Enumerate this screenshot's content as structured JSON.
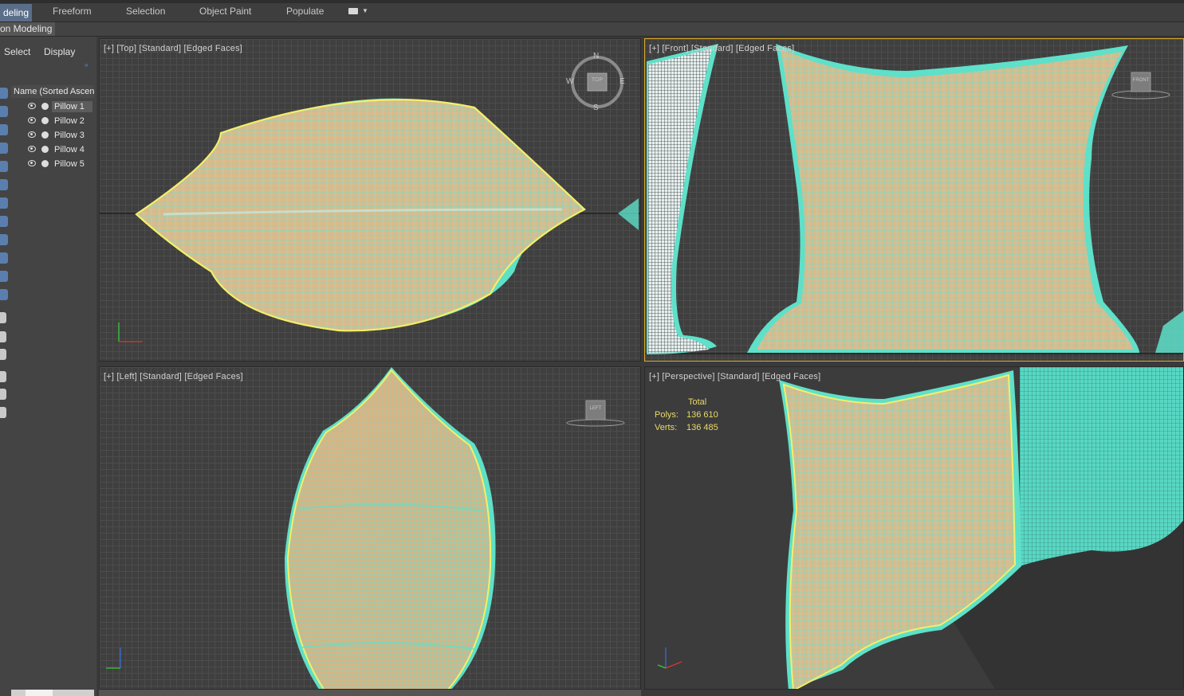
{
  "ribbon": {
    "tabs": [
      "deling",
      "Freeform",
      "Selection",
      "Object Paint",
      "Populate"
    ],
    "extra_icon": "message-dropdown-icon"
  },
  "subribbon": {
    "label": "on Modeling"
  },
  "scene_explorer": {
    "menu": [
      "Select",
      "Display"
    ],
    "column_header": "Name (Sorted Ascending)",
    "items": [
      {
        "label": "Pillow 1",
        "selected": true
      },
      {
        "label": "Pillow 2",
        "selected": false
      },
      {
        "label": "Pillow 3",
        "selected": false
      },
      {
        "label": "Pillow 4",
        "selected": false
      },
      {
        "label": "Pillow 5",
        "selected": false
      }
    ]
  },
  "viewports": {
    "top": {
      "label": "[+] [Top] [Standard] [Edged Faces]",
      "viewcube": {
        "face": "TOP",
        "n": "N",
        "s": "S",
        "e": "E",
        "w": "W"
      }
    },
    "front": {
      "label": "[+] [Front] [Standard] [Edged Faces]",
      "viewcube": {
        "face": "FRONT"
      }
    },
    "left": {
      "label": "[+] [Left] [Standard] [Edged Faces]",
      "viewcube": {
        "face": "LEFT"
      }
    },
    "perspective": {
      "label": "[+] [Perspective] [Standard] [Edged Faces]",
      "stats": {
        "header": "Total",
        "polys_label": "Polys:",
        "polys": "136 610",
        "verts_label": "Verts:",
        "verts": "136 485"
      }
    }
  },
  "colors": {
    "wire": "#5ee0c9",
    "selection": "#f2ef6a",
    "fabric": "#d9b98a",
    "active_border": "#d9a928"
  }
}
